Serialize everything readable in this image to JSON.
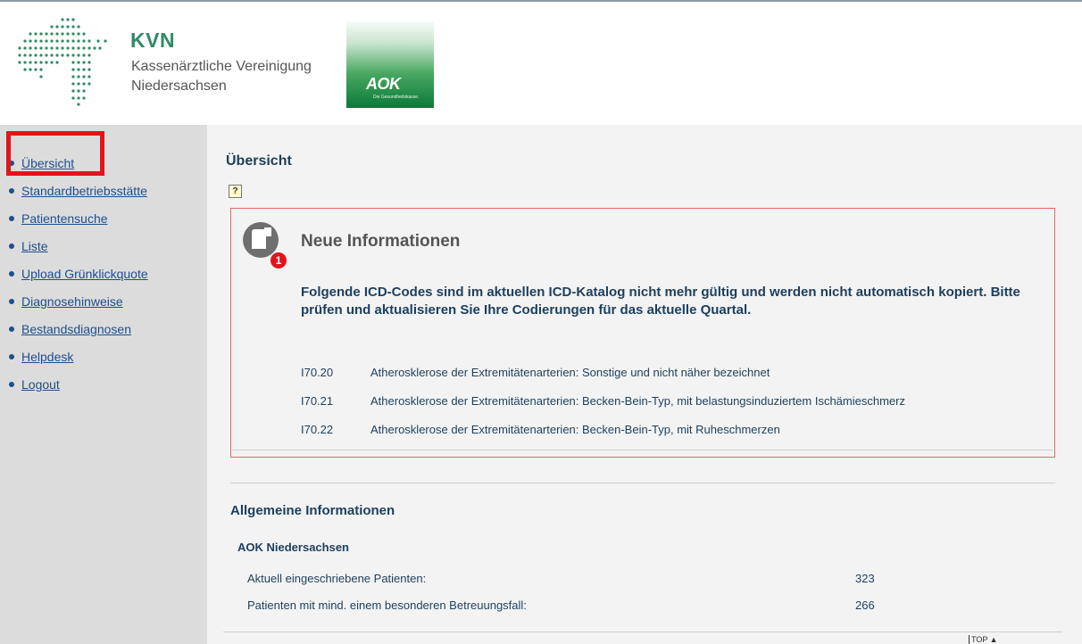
{
  "header": {
    "kvn_brand": "KVN",
    "kvn_line1": "Kassenärztliche Vereinigung",
    "kvn_line2": "Niedersachsen",
    "aok_text": "AOK",
    "aok_sub": "Die Gesundheitskasse."
  },
  "sidebar": {
    "items": [
      {
        "label": "Übersicht"
      },
      {
        "label": "Standardbetriebsstätte"
      },
      {
        "label": "Patientensuche"
      },
      {
        "label": "Liste"
      },
      {
        "label": "Upload Grünklickquote"
      },
      {
        "label": "Diagnosehinweise"
      },
      {
        "label": "Bestandsdiagnosen"
      },
      {
        "label": "Helpdesk"
      },
      {
        "label": "Logout"
      }
    ]
  },
  "main": {
    "title": "Übersicht",
    "help_label": "?",
    "news": {
      "badge": "1",
      "title": "Neue Informationen",
      "message": "Folgende ICD-Codes sind im aktuellen ICD-Katalog nicht mehr gültig und werden nicht automatisch kopiert. Bitte prüfen und aktualisieren Sie Ihre Codierungen für das aktuelle Quartal.",
      "codes": [
        {
          "code": "I70.20",
          "desc": "Atherosklerose der Extremitätenarterien: Sonstige und nicht näher bezeichnet"
        },
        {
          "code": "I70.21",
          "desc": "Atherosklerose der Extremitätenarterien: Becken-Bein-Typ, mit belastungsinduziertem Ischämieschmerz"
        },
        {
          "code": "I70.22",
          "desc": "Atherosklerose der Extremitätenarterien: Becken-Bein-Typ, mit Ruheschmerzen"
        }
      ]
    },
    "general": {
      "title": "Allgemeine Informationen",
      "org": "AOK Niedersachsen",
      "stats": [
        {
          "label": "Aktuell eingeschriebene Patienten:",
          "value": "323"
        },
        {
          "label": "Patienten mit mind. einem besonderen Betreuungsfall:",
          "value": "266"
        }
      ]
    },
    "top_link": "TOP ▲"
  },
  "colors": {
    "kvn_green": "#2f8b63",
    "link_blue": "#1e4f8c",
    "highlight_red": "#e3141b",
    "sidebar_bg": "#dcdcdc",
    "main_bg": "#f3f3f3"
  }
}
